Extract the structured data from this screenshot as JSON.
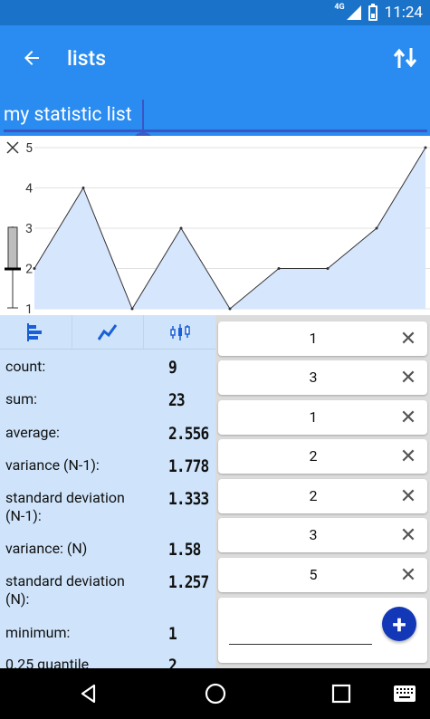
{
  "status_bar": {
    "network": "4G",
    "time": "11:24"
  },
  "app_bar": {
    "title": "lists",
    "back_icon": "arrow-left-icon",
    "sort_icon": "sort-arrows-icon"
  },
  "list_name": {
    "value": "my statistic list"
  },
  "chart_data": {
    "type": "area",
    "x": [
      1,
      2,
      3,
      4,
      5,
      6,
      7,
      8,
      9
    ],
    "values": [
      2,
      4,
      1,
      3,
      1,
      2,
      2,
      3,
      5
    ],
    "ylim": [
      1,
      5
    ],
    "y_ticks": [
      "1",
      "2",
      "3",
      "4",
      "5"
    ],
    "grid": true,
    "fill_color": "#d6e6fd",
    "line_color": "#333333"
  },
  "stats_tabs": [
    {
      "name": "bar-chart-icon"
    },
    {
      "name": "line-chart-icon"
    },
    {
      "name": "candlestick-icon"
    }
  ],
  "stats": [
    {
      "label": "count:",
      "value": "9"
    },
    {
      "label": "sum:",
      "value": "23"
    },
    {
      "label": "average:",
      "value": "2.556"
    },
    {
      "label": "variance (N-1):",
      "value": "1.778"
    },
    {
      "label": "standard deviation (N-1):",
      "value": "1.333"
    },
    {
      "label": "variance: (N)",
      "value": "1.58"
    },
    {
      "label": "standard deviation (N):",
      "value": "1.257"
    },
    {
      "label": "minimum:",
      "value": "1"
    },
    {
      "label": "0.25 quantile",
      "value": "2"
    }
  ],
  "list_items": [
    {
      "value": "1"
    },
    {
      "value": "3"
    },
    {
      "value": "1"
    },
    {
      "value": "2"
    },
    {
      "value": "2"
    },
    {
      "value": "3"
    },
    {
      "value": "5"
    }
  ],
  "add_input": {
    "value": ""
  },
  "colors": {
    "status_bar": "#1a73c9",
    "app_bar": "#2a8cf0",
    "stats_bg": "#cfe4fb",
    "add_button": "#1238b8",
    "tab_icon": "#1a5fd6"
  }
}
